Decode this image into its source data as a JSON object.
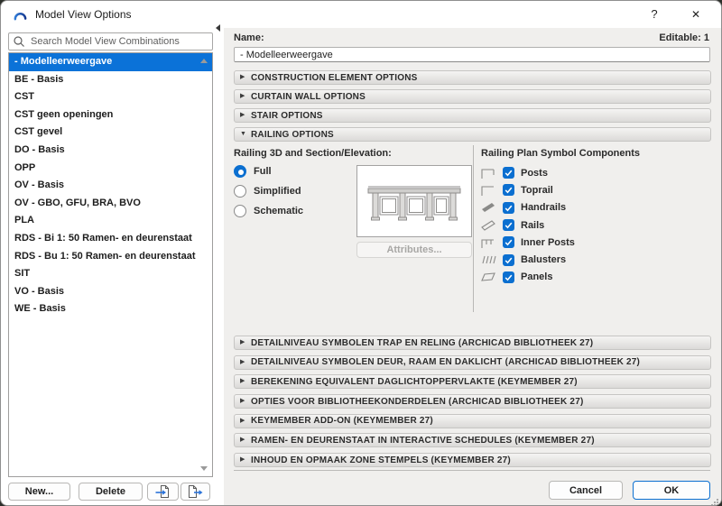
{
  "window": {
    "title": "Model View Options",
    "help_label": "?",
    "close_label": "✕"
  },
  "sidebar": {
    "search_placeholder": "Search Model View Combinations",
    "items": [
      {
        "label": "- Modelleerweergave",
        "selected": true
      },
      {
        "label": "BE - Basis",
        "selected": false
      },
      {
        "label": "CST",
        "selected": false
      },
      {
        "label": "CST geen openingen",
        "selected": false
      },
      {
        "label": "CST gevel",
        "selected": false
      },
      {
        "label": "DO - Basis",
        "selected": false
      },
      {
        "label": "OPP",
        "selected": false
      },
      {
        "label": "OV - Basis",
        "selected": false
      },
      {
        "label": "OV - GBO, GFU, BRA, BVO",
        "selected": false
      },
      {
        "label": "PLA",
        "selected": false
      },
      {
        "label": "RDS - Bi 1: 50 Ramen- en deurenstaat",
        "selected": false
      },
      {
        "label": "RDS - Bu 1: 50 Ramen- en deurenstaat",
        "selected": false
      },
      {
        "label": "SIT",
        "selected": false
      },
      {
        "label": "VO - Basis",
        "selected": false
      },
      {
        "label": "WE - Basis",
        "selected": false
      }
    ],
    "new_button": "New...",
    "delete_button": "Delete"
  },
  "main": {
    "name_label": "Name:",
    "editable_count": "Editable: 1",
    "name_value": "- Modelleerweergave",
    "top_sections": [
      {
        "label": "CONSTRUCTION ELEMENT OPTIONS",
        "expanded": false
      },
      {
        "label": "CURTAIN WALL OPTIONS",
        "expanded": false
      },
      {
        "label": "STAIR OPTIONS",
        "expanded": false
      }
    ],
    "railing": {
      "header": "RAILING OPTIONS",
      "expanded": true,
      "mode_label": "Railing 3D and Section/Elevation:",
      "modes": [
        {
          "label": "Full",
          "selected": true
        },
        {
          "label": "Simplified",
          "selected": false
        },
        {
          "label": "Schematic",
          "selected": false
        }
      ],
      "attributes_button": "Attributes...",
      "components_label": "Railing Plan Symbol Components",
      "components": [
        {
          "label": "Posts",
          "checked": true,
          "icon": "posts-icon"
        },
        {
          "label": "Toprail",
          "checked": true,
          "icon": "toprail-icon"
        },
        {
          "label": "Handrails",
          "checked": true,
          "icon": "handrails-icon"
        },
        {
          "label": "Rails",
          "checked": true,
          "icon": "rails-icon"
        },
        {
          "label": "Inner Posts",
          "checked": true,
          "icon": "inner-posts-icon"
        },
        {
          "label": "Balusters",
          "checked": true,
          "icon": "balusters-icon"
        },
        {
          "label": "Panels",
          "checked": true,
          "icon": "panels-icon"
        }
      ]
    },
    "bottom_sections": [
      {
        "label": "DETAILNIVEAU SYMBOLEN TRAP EN RELING (ARCHICAD BIBLIOTHEEK 27)",
        "expanded": false
      },
      {
        "label": "DETAILNIVEAU SYMBOLEN DEUR, RAAM EN DAKLICHT (ARCHICAD BIBLIOTHEEK 27)",
        "expanded": false
      },
      {
        "label": "BEREKENING EQUIVALENT DAGLICHTOPPERVLAKTE (KEYMEMBER 27)",
        "expanded": false
      },
      {
        "label": "OPTIES VOOR BIBLIOTHEEKONDERDELEN (ARCHICAD BIBLIOTHEEK 27)",
        "expanded": false
      },
      {
        "label": "KEYMEMBER ADD-ON (KEYMEMBER 27)",
        "expanded": false
      },
      {
        "label": "RAMEN- EN DEURENSTAAT IN INTERACTIVE SCHEDULES (KEYMEMBER 27)",
        "expanded": false
      },
      {
        "label": "INHOUD EN OPMAAK ZONE STEMPELS (KEYMEMBER 27)",
        "expanded": false
      }
    ],
    "footer": {
      "cancel_button": "Cancel",
      "ok_button": "OK"
    }
  },
  "colors": {
    "accent": "#0b6fd0",
    "selection": "#0b72d8",
    "panel_bg": "#f0efed",
    "section_border": "#c6c5c3"
  }
}
